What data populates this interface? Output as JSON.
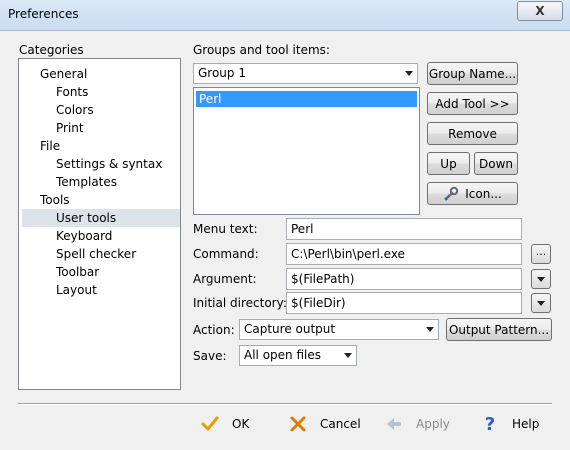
{
  "window": {
    "title": "Preferences",
    "close_glyph": "X"
  },
  "categories": {
    "label": "Categories",
    "items": [
      {
        "label": "General",
        "level": 0
      },
      {
        "label": "Fonts",
        "level": 1
      },
      {
        "label": "Colors",
        "level": 1
      },
      {
        "label": "Print",
        "level": 1
      },
      {
        "label": "File",
        "level": 0
      },
      {
        "label": "Settings & syntax",
        "level": 1
      },
      {
        "label": "Templates",
        "level": 1
      },
      {
        "label": "Tools",
        "level": 0
      },
      {
        "label": "User tools",
        "level": 1,
        "selected": true
      },
      {
        "label": "Keyboard",
        "level": 1
      },
      {
        "label": "Spell checker",
        "level": 1
      },
      {
        "label": "Toolbar",
        "level": 1
      },
      {
        "label": "Layout",
        "level": 1
      }
    ]
  },
  "groups": {
    "label": "Groups and tool items:",
    "selected_group": "Group 1",
    "tools": [
      {
        "label": "Perl",
        "selected": true
      }
    ]
  },
  "buttons": {
    "group_name": "Group Name...",
    "add_tool": "Add Tool >>",
    "remove": "Remove",
    "up": "Up",
    "down": "Down",
    "icon": "Icon...",
    "browse": "...",
    "output_pattern": "Output Pattern..."
  },
  "form": {
    "menu_text_label": "Menu text:",
    "menu_text_value": "Perl",
    "command_label": "Command:",
    "command_value": "C:\\Perl\\bin\\perl.exe",
    "argument_label": "Argument:",
    "argument_value": "$(FilePath)",
    "initial_dir_label": "Initial directory:",
    "initial_dir_value": "$(FileDir)",
    "action_label": "Action:",
    "action_value": "Capture output",
    "save_label": "Save:",
    "save_value": "All open files"
  },
  "footer": {
    "ok": "OK",
    "cancel": "Cancel",
    "apply": "Apply",
    "help": "Help"
  },
  "colors": {
    "selection": "#3399ff",
    "ok_check": "#e8a000",
    "cancel_x": "#e07b00",
    "help": "#2a62c9",
    "disabled": "#8a8a8a"
  }
}
